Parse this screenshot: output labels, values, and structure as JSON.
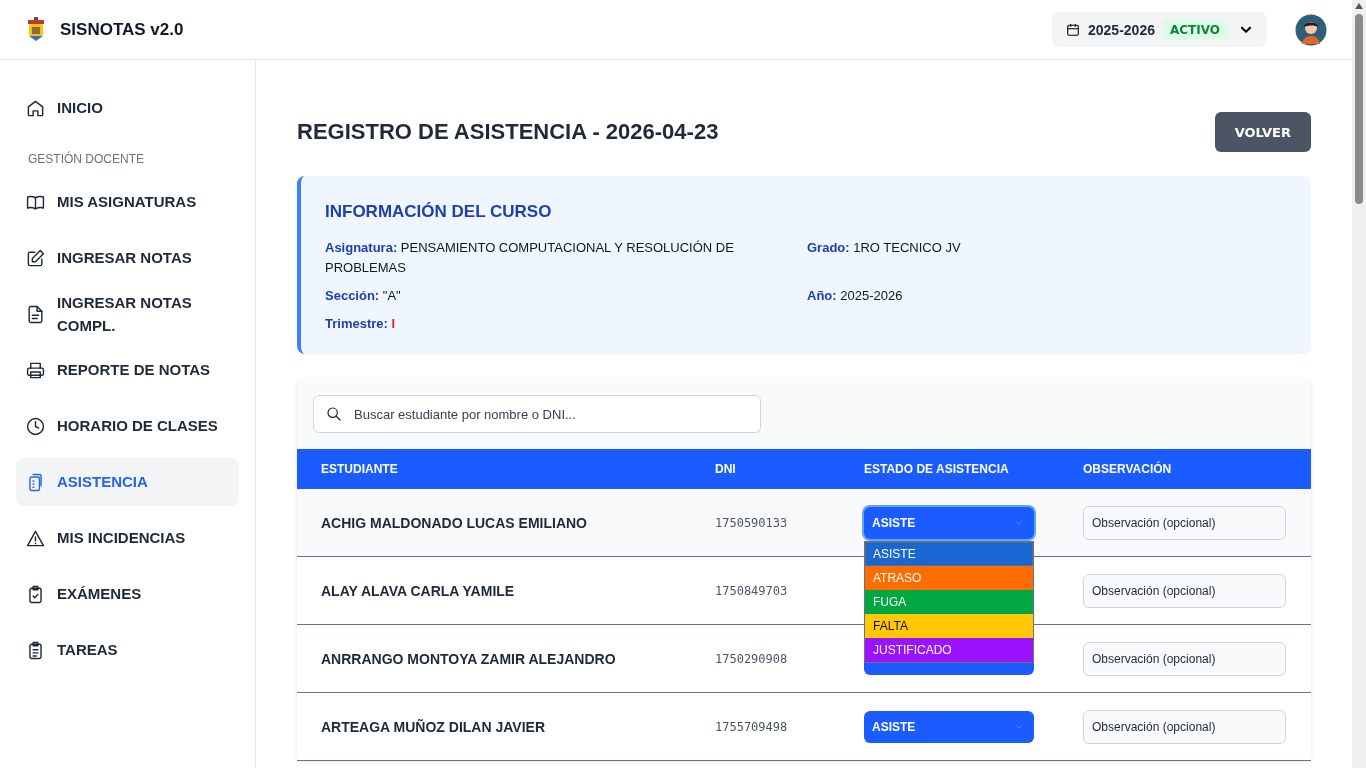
{
  "header": {
    "app_title": "SISNOTAS v2.0",
    "year_selector": {
      "year": "2025-2026",
      "status": "ACTIVO"
    }
  },
  "sidebar": {
    "items": [
      {
        "kind": "link",
        "label": "INICIO",
        "selected": false
      },
      {
        "kind": "section",
        "label": "GESTIÓN DOCENTE"
      },
      {
        "kind": "link",
        "label": "MIS ASIGNATURAS",
        "selected": false
      },
      {
        "kind": "link",
        "label": "INGRESAR NOTAS",
        "selected": false
      },
      {
        "kind": "link",
        "label": "INGRESAR NOTAS COMPL.",
        "selected": false
      },
      {
        "kind": "link",
        "label": "REPORTE DE NOTAS",
        "selected": false
      },
      {
        "kind": "link",
        "label": "HORARIO DE CLASES",
        "selected": false
      },
      {
        "kind": "link",
        "label": "ASISTENCIA",
        "selected": true
      },
      {
        "kind": "link",
        "label": "MIS INCIDENCIAS",
        "selected": false
      },
      {
        "kind": "link",
        "label": "EXÁMENES",
        "selected": false
      },
      {
        "kind": "link",
        "label": "TAREAS",
        "selected": false
      }
    ]
  },
  "page": {
    "title": "REGISTRO DE ASISTENCIA - 2026-04-23",
    "back_button": "VOLVER"
  },
  "course_info": {
    "title": "INFORMACIÓN DEL CURSO",
    "fields": [
      {
        "label": "Asignatura:",
        "value": "PENSAMIENTO COMPUTACIONAL Y RESOLUCIÓN DE PROBLEMAS",
        "emphasized": false
      },
      {
        "label": "Grado:",
        "value": "1RO TECNICO JV",
        "emphasized": false
      },
      {
        "label": "Sección:",
        "value": "\"A\"",
        "emphasized": false
      },
      {
        "label": "Año:",
        "value": "2025-2026",
        "emphasized": false
      },
      {
        "label": "Trimestre:",
        "value": "I",
        "emphasized": true
      }
    ]
  },
  "search": {
    "placeholder": "Buscar estudiante por nombre o DNI..."
  },
  "table": {
    "columns": [
      "ESTUDIANTE",
      "DNI",
      "ESTADO DE ASISTENCIA",
      "OBSERVACIÓN"
    ],
    "rows": [
      {
        "student": "ACHIG MALDONADO LUCAS EMILIANO",
        "dni": "1750590133",
        "status": "ASISTE",
        "expanded": true,
        "observation_placeholder": "Observación (opcional)",
        "options": [
          {
            "label": "ASISTE",
            "color": "#1967d2",
            "selected": true
          },
          {
            "label": "ATRASO",
            "color": "#ff6d00",
            "selected": false
          },
          {
            "label": "FUGA",
            "color": "#00a843",
            "selected": false
          },
          {
            "label": "FALTA",
            "color": "#ffc800",
            "selected": false
          },
          {
            "label": "JUSTIFICADO",
            "color": "#9b12ff",
            "selected": false
          }
        ]
      },
      {
        "student": "ALAY ALAVA CARLA YAMILE",
        "dni": "1750849703",
        "observation_placeholder": "Observación (opcional)"
      },
      {
        "student": "ANRRANGO MONTOYA ZAMIR ALEJANDRO",
        "dni": "1750290908",
        "expanded": false,
        "observation_placeholder": "Observación (opcional)"
      },
      {
        "student": "ARTEAGA MUÑOZ DILAN JAVIER",
        "dni": "1755709498",
        "status": "ASISTE",
        "expanded": false,
        "observation_placeholder": "Observación (opcional)"
      }
    ]
  }
}
